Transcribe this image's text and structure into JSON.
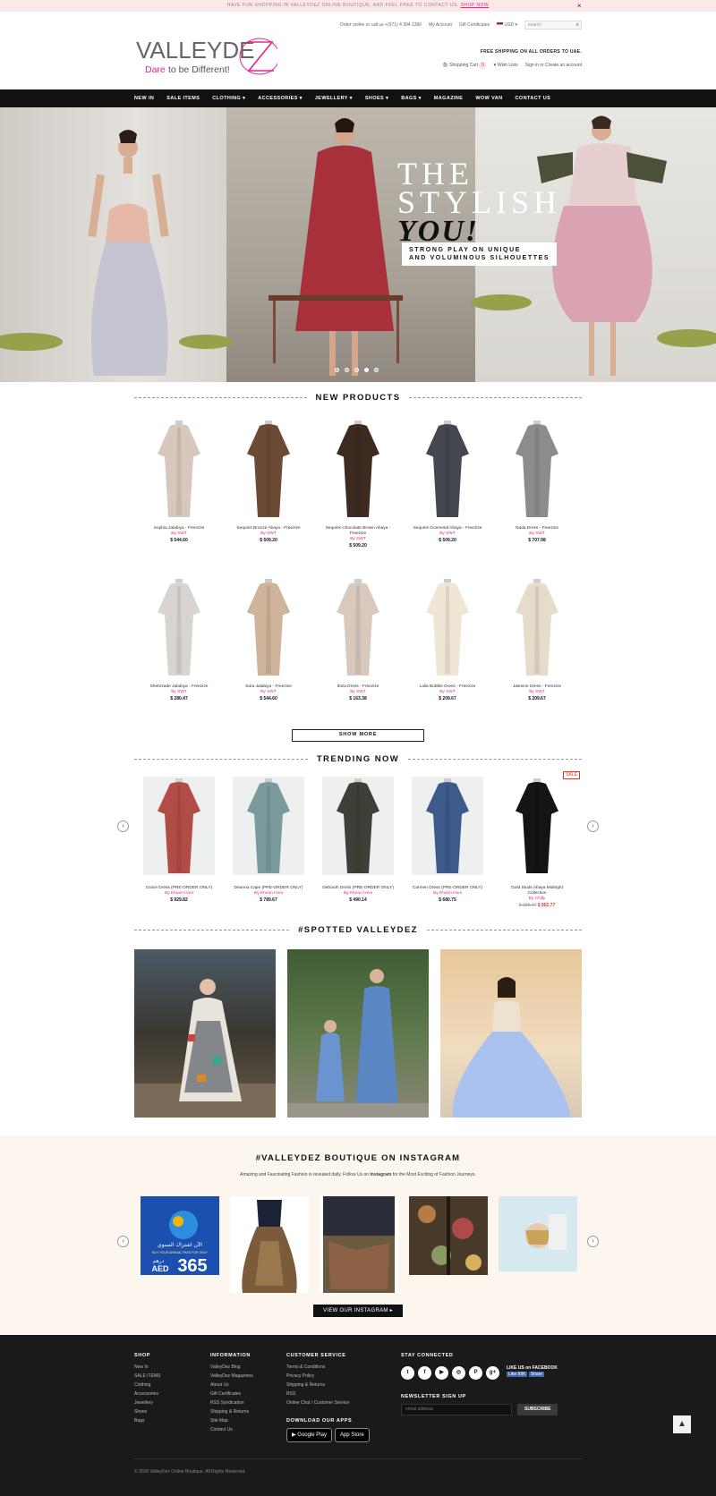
{
  "promo": {
    "text": "HAVE FUN SHOPPING IN VALLEYDEZ ONLINE BOUTIQUE, AND FEEL FREE TO CONTACT US.",
    "link": "SHOP NOW",
    "close": "×"
  },
  "header": {
    "order_text": "Order online or call us +(971) 4 394 1390",
    "my_account": "My Account",
    "gift_certificates": "Gift Certificates",
    "currency": "USD",
    "search_placeholder": "search",
    "logo_main": "VALLEYDEZ",
    "logo_tagline": "Dare to be Different!",
    "free_shipping": "FREE SHIPPING ON ALL ORDERS TO UAE.",
    "cart": "Shopping Cart",
    "cart_count": "0",
    "wishlist": "Wish Lists",
    "signin": "Sign in or Create an account"
  },
  "nav": [
    "NEW IN",
    "SALE ITEMS",
    "CLOTHING",
    "ACCESSORIES",
    "JEWELLERY",
    "SHOES",
    "BAGS",
    "MAGAZINE",
    "WOW VAN",
    "CONTACT US"
  ],
  "nav_dropdowns": [
    "CLOTHING",
    "ACCESSORIES",
    "JEWELLERY",
    "SHOES",
    "BAGS"
  ],
  "hero": {
    "line1": "THE",
    "line2": "STYLISH",
    "line3": "YOU!",
    "sub1": "STRONG PLAY ON UNIQUE",
    "sub2": "AND VOLUMINOUS SILHOUETTES"
  },
  "sections": {
    "new": "NEW PRODUCTS",
    "trending": "TRENDING NOW",
    "spotted": "#SPOTTED VALLEYDEZ",
    "show_more": "SHOW MORE"
  },
  "new_products": [
    {
      "name": "Sophia Jalabiya - Freezize",
      "by": "By SWT",
      "price": "$ 544.60",
      "color": "#d8c7bd"
    },
    {
      "name": "Sequins Bronze Abaya - Freezize",
      "by": "By SWT",
      "price": "$ 509.20",
      "color": "#6b4a36"
    },
    {
      "name": "Sequins Chocolate Brown Abaya - Freezize",
      "by": "By SWT",
      "price": "$ 509.20",
      "color": "#3d2b22"
    },
    {
      "name": "Sequins Gunmetal Abaya - Freezize",
      "by": "By SWT",
      "price": "$ 509.20",
      "color": "#444650"
    },
    {
      "name": "Nada Dress - Freezize",
      "by": "By SWT",
      "price": "$ 707.98",
      "color": "#8c8c8e"
    },
    {
      "name": "Shehrzade Jalabiya - Freezize",
      "by": "By SWT",
      "price": "$ 280.47",
      "color": "#d9d4cf"
    },
    {
      "name": "Sara Jalabiya - Freezize",
      "by": "By SWT",
      "price": "$ 544.60",
      "color": "#cdb49a"
    },
    {
      "name": "Ibiza Dress - Freezize",
      "by": "By SWT",
      "price": "$ 163.38",
      "color": "#d8c9bc"
    },
    {
      "name": "Laila Bubble Dress - Freezize",
      "by": "By SWT",
      "price": "$ 209.67",
      "color": "#efe6d4"
    },
    {
      "name": "Jasmine Dress - Freezize",
      "by": "By SWT",
      "price": "$ 209.67",
      "color": "#e6dccb"
    }
  ],
  "trending": [
    {
      "name": "Grace Dress (PRE-ORDER ONLY)",
      "by": "By Khoon Hooi",
      "price": "$ 929.82",
      "color": "#b24c46"
    },
    {
      "name": "Deanna Cape (PRE-ORDER ONLY)",
      "by": "By Khoon Hooi",
      "price": "$ 789.67",
      "color": "#7a9a9c"
    },
    {
      "name": "Deborah Dress (PRE-ORDER ONLY)",
      "by": "By Khoon Hooi",
      "price": "$ 490.14",
      "color": "#3c4036"
    },
    {
      "name": "Carmen Dress (PRE-ORDER ONLY)",
      "by": "By Khoon Hooi",
      "price": "$ 680.75",
      "color": "#3d5a8a"
    },
    {
      "name": "Gold Studs Abaya Midnight Collection",
      "by": "By Chilly",
      "old_price": "$ 189.47",
      "price": "$ 952.77",
      "color": "#141414",
      "sale": "SALE"
    }
  ],
  "instagram": {
    "title": "#VALLEYDEZ BOUTIQUE ON INSTAGRAM",
    "desc_before": "Amazing and Fascinating Fashion is revealed daily. Follow Us on ",
    "desc_bold": "Instagram",
    "desc_after": " for the Most Exciting of Fashion Journeys.",
    "ad_line1": "الآن اشتراك السنوي",
    "ad_line2": "BUY YOUR ANNUAL PASS FOR ONLY",
    "ad_price": "365",
    "ad_currency": "AED",
    "ad_ar": "درهم",
    "button": "VIEW OUR INSTAGRAM"
  },
  "footer": {
    "shop": {
      "title": "SHOP",
      "items": [
        "New In",
        "SALE ITEMS",
        "Clothing",
        "Accessories",
        "Jewellery",
        "Shoes",
        "Bags"
      ]
    },
    "info": {
      "title": "INFORMATION",
      "items": [
        "ValleyDez Blog",
        "ValleyDez Magazines",
        "About Us",
        "Gift Certificates",
        "RSS Syndication",
        "Shipping & Returns",
        "Site Map",
        "Contact Us"
      ]
    },
    "service": {
      "title": "CUSTOMER SERVICE",
      "items": [
        "Terms & Conditions",
        "Privacy Policy",
        "Shipping & Returns",
        "RSS",
        "Online Chat / Customer Service"
      ]
    },
    "apps_title": "DOWNLOAD OUR APPS",
    "google_play": "Google Play",
    "app_store": "App Store",
    "stay": "STAY CONNECTED",
    "like_us": "LIKE US on FACEBOOK",
    "fb_like": "Like 99K",
    "fb_share": "Share",
    "newsletter": "NEWSLETTER SIGN UP",
    "email_placeholder": "email address",
    "subscribe": "SUBSCRIBE",
    "copyright": "© 2016 ValleyDez Online Boutique. All Rights Reserved."
  }
}
